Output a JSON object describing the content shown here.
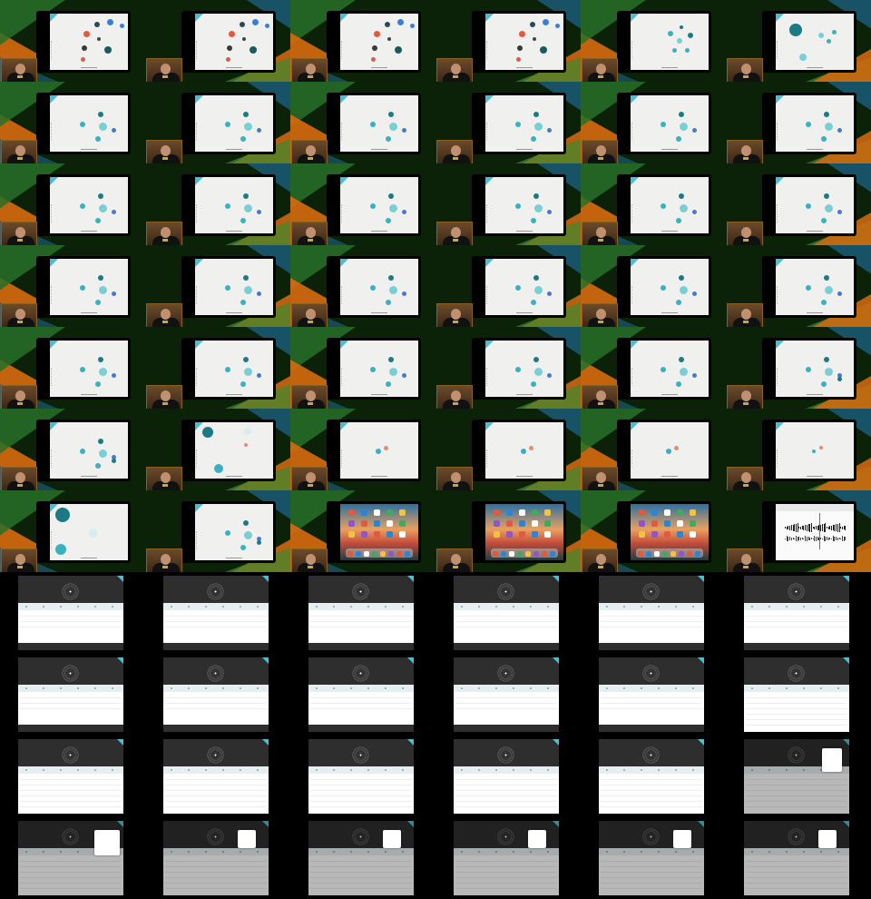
{
  "colors": {
    "teal_dark": "#1c7a84",
    "teal_mid": "#3ab1c0",
    "teal_light": "#78cfd8",
    "blue_app": "#3b7dd8",
    "red_app": "#e05a42",
    "salmon": "#e88a70",
    "bg_green": "#0b2208",
    "bg_orange": "#d86a10",
    "bg_blue": "#1a5a78"
  },
  "video_thumbnails": {
    "rows": 7,
    "cols": 6,
    "frames": [
      {
        "variant": "apps"
      },
      {
        "variant": "apps"
      },
      {
        "variant": "apps"
      },
      {
        "variant": "apps"
      },
      {
        "variant": "cluster_small"
      },
      {
        "variant": "cluster_big"
      },
      {
        "variant": "map"
      },
      {
        "variant": "map"
      },
      {
        "variant": "map"
      },
      {
        "variant": "map"
      },
      {
        "variant": "map"
      },
      {
        "variant": "map"
      },
      {
        "variant": "map"
      },
      {
        "variant": "map"
      },
      {
        "variant": "map"
      },
      {
        "variant": "map"
      },
      {
        "variant": "map"
      },
      {
        "variant": "map"
      },
      {
        "variant": "map"
      },
      {
        "variant": "map"
      },
      {
        "variant": "map"
      },
      {
        "variant": "map"
      },
      {
        "variant": "map"
      },
      {
        "variant": "map"
      },
      {
        "variant": "map"
      },
      {
        "variant": "map"
      },
      {
        "variant": "map"
      },
      {
        "variant": "map"
      },
      {
        "variant": "map"
      },
      {
        "variant": "map_dark"
      },
      {
        "variant": "map_dark"
      },
      {
        "variant": "expand"
      },
      {
        "variant": "pair"
      },
      {
        "variant": "pair"
      },
      {
        "variant": "pair"
      },
      {
        "variant": "pair_small"
      },
      {
        "variant": "expand2"
      },
      {
        "variant": "map_dark"
      },
      {
        "variant": "home"
      },
      {
        "variant": "home"
      },
      {
        "variant": "home"
      },
      {
        "variant": "audio"
      }
    ]
  },
  "voice_memos": {
    "rows": 4,
    "cols": 6,
    "frames": [
      {
        "variant": "list3"
      },
      {
        "variant": "list3"
      },
      {
        "variant": "list3"
      },
      {
        "variant": "list3"
      },
      {
        "variant": "list3"
      },
      {
        "variant": "list3"
      },
      {
        "variant": "list3"
      },
      {
        "variant": "list3"
      },
      {
        "variant": "list3"
      },
      {
        "variant": "list3"
      },
      {
        "variant": "list3"
      },
      {
        "variant": "list6"
      },
      {
        "variant": "list6"
      },
      {
        "variant": "list6"
      },
      {
        "variant": "list6"
      },
      {
        "variant": "list6"
      },
      {
        "variant": "list6"
      },
      {
        "variant": "menu_right"
      },
      {
        "variant": "menu_mid"
      },
      {
        "variant": "menu_small"
      },
      {
        "variant": "menu_small"
      },
      {
        "variant": "menu_small"
      },
      {
        "variant": "menu_small"
      },
      {
        "variant": "menu_small"
      }
    ]
  }
}
